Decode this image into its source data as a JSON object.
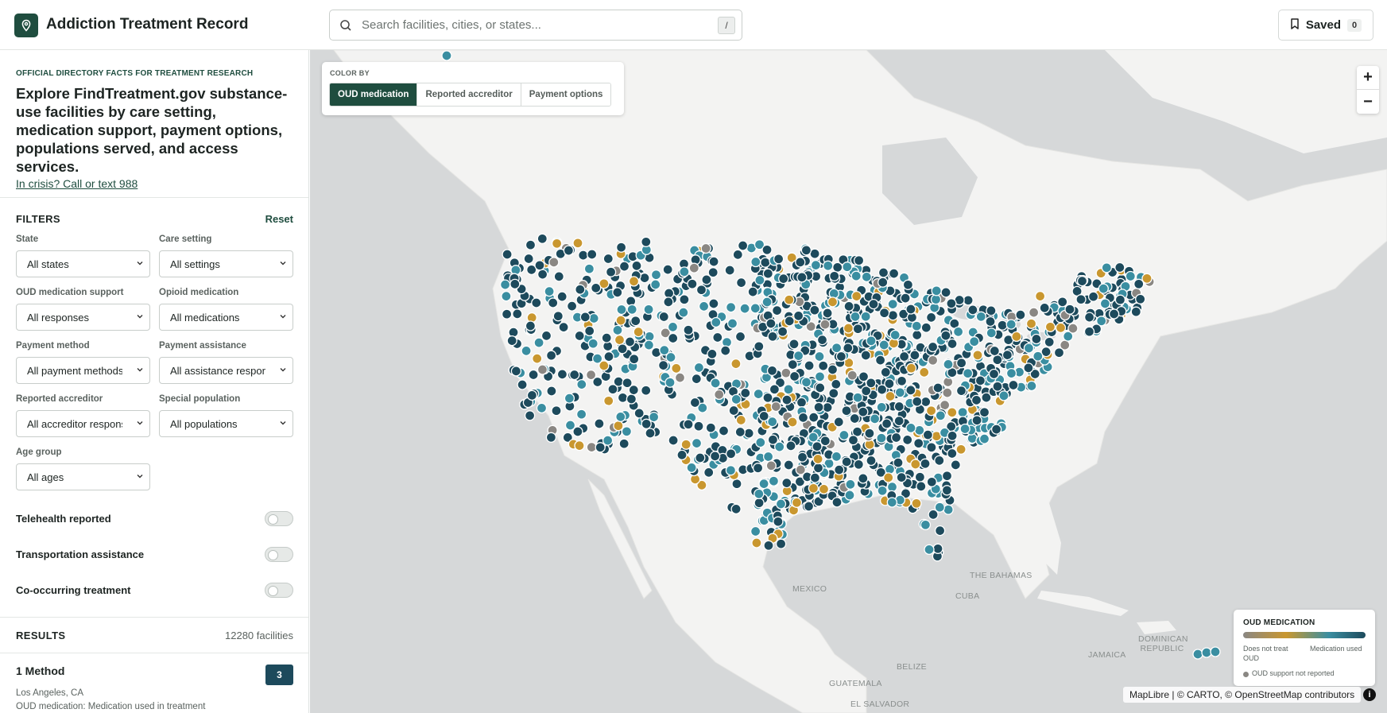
{
  "header": {
    "app_title": "Addiction Treatment Record",
    "logo_icon": "map-pin-icon",
    "search_placeholder": "Search facilities, cities, or states...",
    "search_shortcut": "/",
    "saved_label": "Saved",
    "saved_count": "0"
  },
  "intro": {
    "kicker": "OFFICIAL DIRECTORY FACTS FOR TREATMENT RESEARCH",
    "headline": "Explore FindTreatment.gov substance-use facilities by care setting, medication support, payment options, populations served, and access services.",
    "crisis_link": "In crisis? Call or text 988"
  },
  "filters": {
    "title": "FILTERS",
    "reset": "Reset",
    "selects": [
      {
        "label": "State",
        "value": "All states"
      },
      {
        "label": "Care setting",
        "value": "All settings"
      },
      {
        "label": "OUD medication support",
        "value": "All responses"
      },
      {
        "label": "Opioid medication",
        "value": "All medications"
      },
      {
        "label": "Payment method",
        "value": "All payment methods"
      },
      {
        "label": "Payment assistance",
        "value": "All assistance responses"
      },
      {
        "label": "Reported accreditor",
        "value": "All accreditor responses"
      },
      {
        "label": "Special population",
        "value": "All populations"
      },
      {
        "label": "Age group",
        "value": "All ages"
      }
    ],
    "toggles": [
      {
        "label": "Telehealth reported",
        "on": false
      },
      {
        "label": "Transportation assistance",
        "on": false
      },
      {
        "label": "Co-occurring treatment",
        "on": false
      }
    ]
  },
  "results": {
    "title": "RESULTS",
    "count": "12280 facilities",
    "first": {
      "name": "1 Method",
      "badge": "3",
      "city": "Los Angeles, CA",
      "oud": "OUD medication: Medication used in treatment"
    }
  },
  "map": {
    "color_by_label": "COLOR BY",
    "color_by_options": [
      "OUD medication",
      "Reported accreditor",
      "Payment options"
    ],
    "color_by_active": "OUD medication",
    "zoom_in": "+",
    "zoom_out": "−",
    "place_labels": [
      "MEXICO",
      "CUBA",
      "THE BAHAMAS",
      "DOMINICAN REPUBLIC",
      "JAMAICA",
      "BELIZE",
      "GUATEMALA",
      "EL SALVADOR"
    ],
    "legend": {
      "title": "OUD MEDICATION",
      "left": "Does not treat OUD",
      "right": "Medication used",
      "not_reported": "OUD support not reported"
    },
    "attribution": "MapLibre | © CARTO, © OpenStreetMap contributors",
    "info_icon": "info-icon",
    "colors": {
      "medication_used": "#1d4a5c",
      "mid": "#3a8ea1",
      "does_not_treat": "#c9972f",
      "not_reported": "#8a8783",
      "accent": "#1f4d3f"
    }
  }
}
